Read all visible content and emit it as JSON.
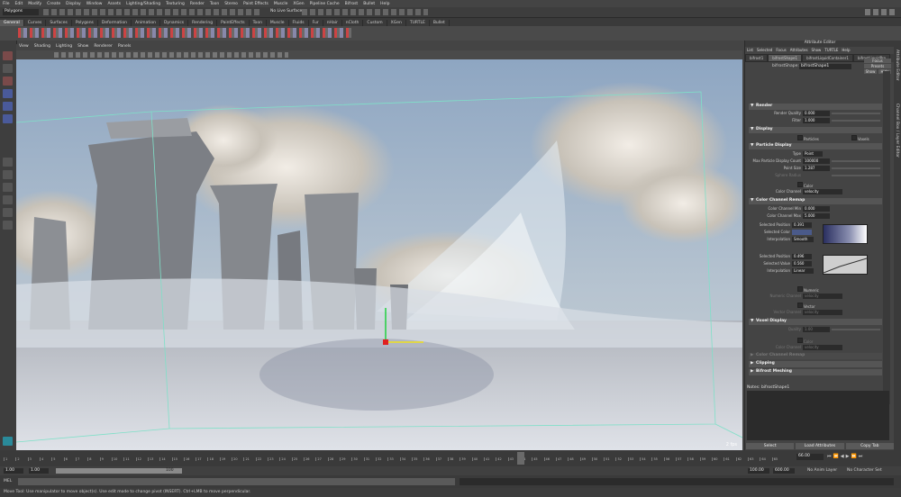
{
  "menubar": [
    "File",
    "Edit",
    "Modify",
    "Create",
    "Display",
    "Window",
    "Assets",
    "Lighting/Shading",
    "Texturing",
    "Render",
    "Toon",
    "Stereo",
    "Paint Effects",
    "Muscle",
    "XGen",
    "Pipeline Cache",
    "Bifrost",
    "Bullet",
    "Help"
  ],
  "status": {
    "mode": "Polygons",
    "live_surface": "No Live Surface"
  },
  "shelf_tabs": [
    "General",
    "Curves",
    "Surfaces",
    "Polygons",
    "Deformation",
    "Animation",
    "Dynamics",
    "Rendering",
    "PaintEffects",
    "Toon",
    "Muscle",
    "Fluids",
    "Fur",
    "nHair",
    "nCloth",
    "Custom",
    "XGen",
    "TURTLE",
    "Bullet"
  ],
  "panel_menu": [
    "View",
    "Shading",
    "Lighting",
    "Show",
    "Renderer",
    "Panels"
  ],
  "viewport": {
    "fps": "2 fps"
  },
  "attribute_editor": {
    "title": "Attribute Editor",
    "menu": [
      "List",
      "Selected",
      "Focus",
      "Attributes",
      "Show",
      "TURTLE",
      "Help"
    ],
    "tabs": [
      "bifrost1",
      "bifrostShape1",
      "bifrostLiquidContainer1",
      "bifrostLiquidPro"
    ],
    "shape_label": "bifrostShape:",
    "shape_value": "bifrostShape1",
    "focus": "Focus",
    "presets": "Presets",
    "show": "Show",
    "hide": "Hide",
    "sections": {
      "render": "Render",
      "display": "Display",
      "particle_display": "Particle Display",
      "color_remap": "Color Channel Remap",
      "voxel_display": "Voxel Display",
      "voxel_remap": "Color Channel Remap",
      "clipping": "Clipping",
      "meshing": "Bifrost Meshing"
    },
    "render_quality_label": "Render Quality",
    "render_quality": "0.000",
    "filter_label": "Filter",
    "filter": "1.000",
    "particles_label": "Particles",
    "voxels_label": "Voxels",
    "type_label": "Type",
    "type_value": "Point",
    "max_count_label": "Max Particle Display Count",
    "max_count": "100000",
    "point_size_label": "Point Size",
    "point_size": "1.287",
    "sphere_radius_label": "Sphere Radius",
    "color_label": "Color",
    "color_channel_label": "Color Channel",
    "color_channel": "velocity",
    "cc_min_label": "Color Channel Min",
    "cc_min": "0.000",
    "cc_max_label": "Color Channel Max",
    "cc_max": "5.000",
    "sel_pos_label": "Selected Position",
    "sel_pos": "0.391",
    "sel_color_label": "Selected Color",
    "interp_label": "Interpolation",
    "interp": "Smooth",
    "sel_pos2_label": "Selected Position",
    "sel_pos2": "0.496",
    "sel_val_label": "Selected Value",
    "sel_val": "0.560",
    "interp2_label": "Interpolation",
    "interp2": "Linear",
    "numeric_label": "Numeric",
    "numeric_channel_label": "Numeric Channel",
    "numeric_channel": "velocity",
    "vector_label": "Vector",
    "vector_channel_label": "Vector Channel",
    "vector_channel": "velocity",
    "quality_label": "Quality",
    "quality": "1.00",
    "voxel_color_label": "Color",
    "voxel_cc_label": "Color Channel",
    "voxel_cc": "velocity",
    "notes_label": "Notes: bifrostShape1",
    "buttons": [
      "Select",
      "Load Attributes",
      "Copy Tab"
    ]
  },
  "side_strip_labels": [
    "Attribute Editor",
    "Channel Box / Layer Editor"
  ],
  "time": {
    "ticks": [
      "1",
      "2",
      "3",
      "4",
      "5",
      "6",
      "7",
      "8",
      "9",
      "10",
      "11",
      "12",
      "13",
      "14",
      "15",
      "16",
      "17",
      "18",
      "19",
      "20",
      "21",
      "22",
      "23",
      "24",
      "25",
      "26",
      "27",
      "28",
      "29",
      "30",
      "31",
      "32",
      "33",
      "34",
      "35",
      "36",
      "37",
      "38",
      "39",
      "40",
      "41",
      "42",
      "43",
      "44",
      "45",
      "46",
      "47",
      "48",
      "49",
      "50",
      "51",
      "52",
      "53",
      "54",
      "55",
      "56",
      "57",
      "58",
      "59",
      "60",
      "61",
      "62",
      "63",
      "64",
      "65"
    ],
    "current": "66.00",
    "range_start": "1.00",
    "range_inner_start": "1.00",
    "range_inner_end": "100",
    "range_end": "100.00",
    "anim_end": "600.00",
    "anim_layer": "No Anim Layer",
    "char_set": "No Character Set"
  },
  "cmd": {
    "label": "MEL"
  },
  "help": "Move Tool: Use manipulator to move object(s). Use edit mode to change pivot (INSERT). Ctrl+LMB to move perpendicular."
}
